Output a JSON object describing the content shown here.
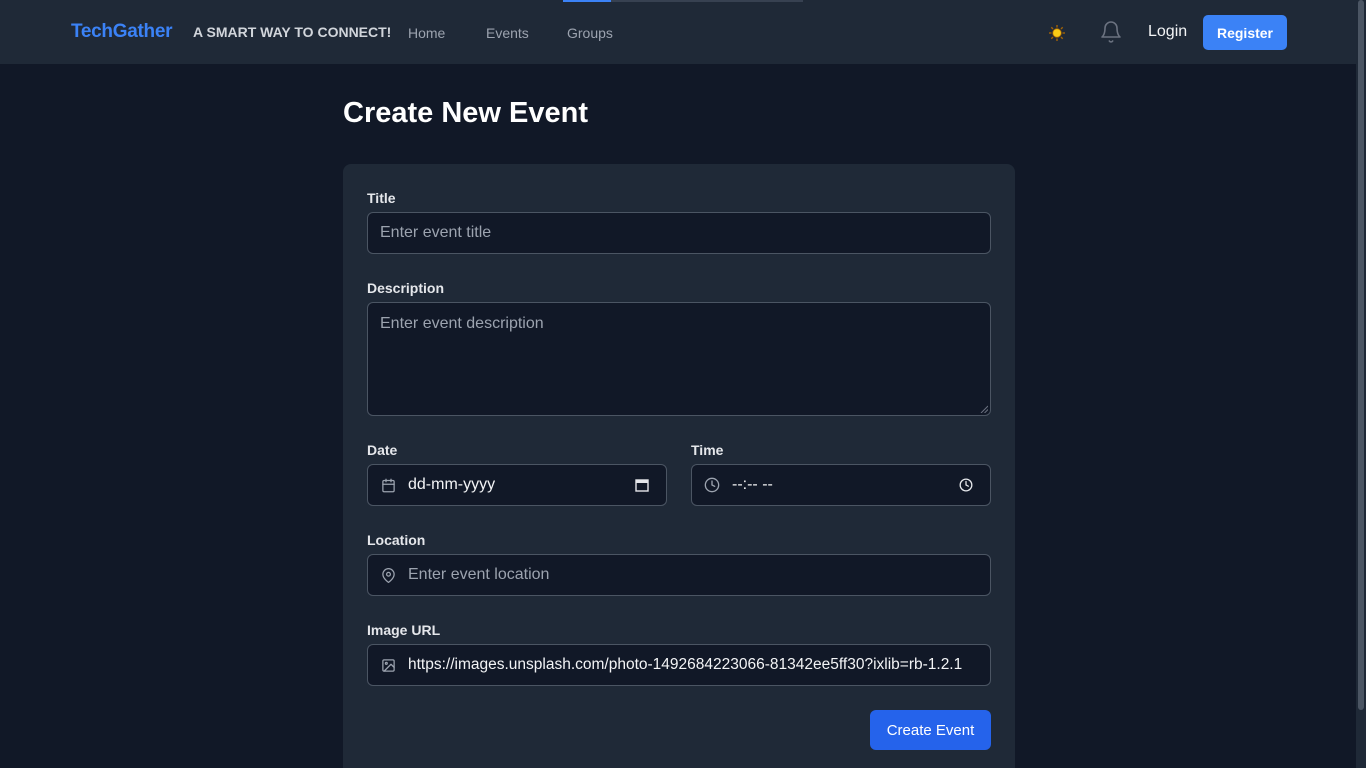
{
  "nav": {
    "brand": "TechGather",
    "tagline": "A SMART WAY TO CONNECT!",
    "links": [
      "Home",
      "Events",
      "Groups"
    ],
    "login": "Login",
    "register": "Register"
  },
  "page": {
    "title": "Create New Event"
  },
  "form": {
    "title": {
      "label": "Title",
      "placeholder": "Enter event title"
    },
    "description": {
      "label": "Description",
      "placeholder": "Enter event description"
    },
    "date": {
      "label": "Date",
      "value": "dd-mm-yyyy"
    },
    "time": {
      "label": "Time",
      "value": "--:-- --"
    },
    "location": {
      "label": "Location",
      "placeholder": "Enter event location"
    },
    "image_url": {
      "label": "Image URL",
      "value": "https://images.unsplash.com/photo-1492684223066-81342ee5ff30?ixlib=rb-1.2.1"
    },
    "submit": "Create Event"
  },
  "icons": {
    "theme": "sun-icon",
    "notifications": "bell-icon",
    "date": "calendar-icon",
    "time": "clock-icon",
    "location": "map-pin-icon",
    "image": "image-icon"
  },
  "colors": {
    "accent": "#3b82f6",
    "button": "#2563eb",
    "background": "#111827",
    "surface": "#1f2937"
  }
}
